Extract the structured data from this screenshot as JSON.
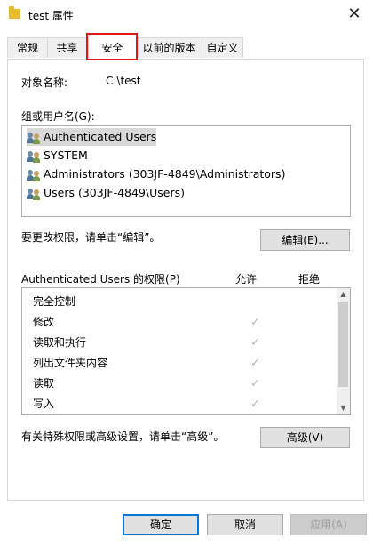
{
  "window": {
    "title": "test 属性",
    "close_glyph": "✕"
  },
  "tabs": [
    {
      "label": "常规"
    },
    {
      "label": "共享"
    },
    {
      "label": "安全",
      "active": true
    },
    {
      "label": "以前的版本"
    },
    {
      "label": "自定义"
    }
  ],
  "security": {
    "object_name_label": "对象名称:",
    "object_name_value": "C:\\test",
    "group_label": "组或用户名(G):",
    "users": [
      {
        "name": "Authenticated Users",
        "selected": true
      },
      {
        "name": "SYSTEM"
      },
      {
        "name": "Administrators (303JF-4849\\Administrators)"
      },
      {
        "name": "Users (303JF-4849\\Users)"
      }
    ],
    "change_hint": "要更改权限，请单击“编辑”。",
    "edit_button": "编辑(E)...",
    "permissions_header": "Authenticated Users 的权限(P)",
    "allow_header": "允许",
    "deny_header": "拒绝",
    "permissions": [
      {
        "name": "完全控制",
        "allow": false
      },
      {
        "name": "修改",
        "allow": true
      },
      {
        "name": "读取和执行",
        "allow": true
      },
      {
        "name": "列出文件夹内容",
        "allow": true
      },
      {
        "name": "读取",
        "allow": true
      },
      {
        "name": "写入",
        "allow": true
      }
    ],
    "check_glyph": "✓",
    "advanced_hint": "有关特殊权限或高级设置，请单击“高级”。",
    "advanced_button": "高级(V)"
  },
  "footer": {
    "ok": "确定",
    "cancel": "取消",
    "apply": "应用(A)"
  },
  "colors": {
    "highlight": "#e01515",
    "selection": "#d9d9d9",
    "primary_border": "#0078d7"
  }
}
